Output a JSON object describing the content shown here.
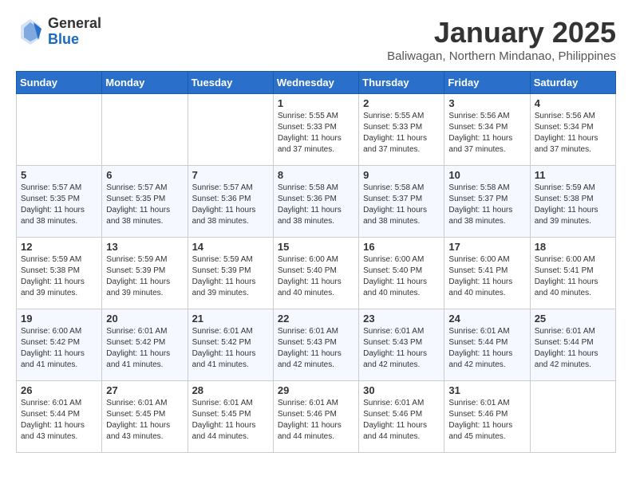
{
  "header": {
    "logo_general": "General",
    "logo_blue": "Blue",
    "month_year": "January 2025",
    "location": "Baliwagan, Northern Mindanao, Philippines"
  },
  "weekdays": [
    "Sunday",
    "Monday",
    "Tuesday",
    "Wednesday",
    "Thursday",
    "Friday",
    "Saturday"
  ],
  "weeks": [
    [
      {
        "day": "",
        "content": ""
      },
      {
        "day": "",
        "content": ""
      },
      {
        "day": "",
        "content": ""
      },
      {
        "day": "1",
        "content": "Sunrise: 5:55 AM\nSunset: 5:33 PM\nDaylight: 11 hours\nand 37 minutes."
      },
      {
        "day": "2",
        "content": "Sunrise: 5:55 AM\nSunset: 5:33 PM\nDaylight: 11 hours\nand 37 minutes."
      },
      {
        "day": "3",
        "content": "Sunrise: 5:56 AM\nSunset: 5:34 PM\nDaylight: 11 hours\nand 37 minutes."
      },
      {
        "day": "4",
        "content": "Sunrise: 5:56 AM\nSunset: 5:34 PM\nDaylight: 11 hours\nand 37 minutes."
      }
    ],
    [
      {
        "day": "5",
        "content": "Sunrise: 5:57 AM\nSunset: 5:35 PM\nDaylight: 11 hours\nand 38 minutes."
      },
      {
        "day": "6",
        "content": "Sunrise: 5:57 AM\nSunset: 5:35 PM\nDaylight: 11 hours\nand 38 minutes."
      },
      {
        "day": "7",
        "content": "Sunrise: 5:57 AM\nSunset: 5:36 PM\nDaylight: 11 hours\nand 38 minutes."
      },
      {
        "day": "8",
        "content": "Sunrise: 5:58 AM\nSunset: 5:36 PM\nDaylight: 11 hours\nand 38 minutes."
      },
      {
        "day": "9",
        "content": "Sunrise: 5:58 AM\nSunset: 5:37 PM\nDaylight: 11 hours\nand 38 minutes."
      },
      {
        "day": "10",
        "content": "Sunrise: 5:58 AM\nSunset: 5:37 PM\nDaylight: 11 hours\nand 38 minutes."
      },
      {
        "day": "11",
        "content": "Sunrise: 5:59 AM\nSunset: 5:38 PM\nDaylight: 11 hours\nand 39 minutes."
      }
    ],
    [
      {
        "day": "12",
        "content": "Sunrise: 5:59 AM\nSunset: 5:38 PM\nDaylight: 11 hours\nand 39 minutes."
      },
      {
        "day": "13",
        "content": "Sunrise: 5:59 AM\nSunset: 5:39 PM\nDaylight: 11 hours\nand 39 minutes."
      },
      {
        "day": "14",
        "content": "Sunrise: 5:59 AM\nSunset: 5:39 PM\nDaylight: 11 hours\nand 39 minutes."
      },
      {
        "day": "15",
        "content": "Sunrise: 6:00 AM\nSunset: 5:40 PM\nDaylight: 11 hours\nand 40 minutes."
      },
      {
        "day": "16",
        "content": "Sunrise: 6:00 AM\nSunset: 5:40 PM\nDaylight: 11 hours\nand 40 minutes."
      },
      {
        "day": "17",
        "content": "Sunrise: 6:00 AM\nSunset: 5:41 PM\nDaylight: 11 hours\nand 40 minutes."
      },
      {
        "day": "18",
        "content": "Sunrise: 6:00 AM\nSunset: 5:41 PM\nDaylight: 11 hours\nand 40 minutes."
      }
    ],
    [
      {
        "day": "19",
        "content": "Sunrise: 6:00 AM\nSunset: 5:42 PM\nDaylight: 11 hours\nand 41 minutes."
      },
      {
        "day": "20",
        "content": "Sunrise: 6:01 AM\nSunset: 5:42 PM\nDaylight: 11 hours\nand 41 minutes."
      },
      {
        "day": "21",
        "content": "Sunrise: 6:01 AM\nSunset: 5:42 PM\nDaylight: 11 hours\nand 41 minutes."
      },
      {
        "day": "22",
        "content": "Sunrise: 6:01 AM\nSunset: 5:43 PM\nDaylight: 11 hours\nand 42 minutes."
      },
      {
        "day": "23",
        "content": "Sunrise: 6:01 AM\nSunset: 5:43 PM\nDaylight: 11 hours\nand 42 minutes."
      },
      {
        "day": "24",
        "content": "Sunrise: 6:01 AM\nSunset: 5:44 PM\nDaylight: 11 hours\nand 42 minutes."
      },
      {
        "day": "25",
        "content": "Sunrise: 6:01 AM\nSunset: 5:44 PM\nDaylight: 11 hours\nand 42 minutes."
      }
    ],
    [
      {
        "day": "26",
        "content": "Sunrise: 6:01 AM\nSunset: 5:44 PM\nDaylight: 11 hours\nand 43 minutes."
      },
      {
        "day": "27",
        "content": "Sunrise: 6:01 AM\nSunset: 5:45 PM\nDaylight: 11 hours\nand 43 minutes."
      },
      {
        "day": "28",
        "content": "Sunrise: 6:01 AM\nSunset: 5:45 PM\nDaylight: 11 hours\nand 44 minutes."
      },
      {
        "day": "29",
        "content": "Sunrise: 6:01 AM\nSunset: 5:46 PM\nDaylight: 11 hours\nand 44 minutes."
      },
      {
        "day": "30",
        "content": "Sunrise: 6:01 AM\nSunset: 5:46 PM\nDaylight: 11 hours\nand 44 minutes."
      },
      {
        "day": "31",
        "content": "Sunrise: 6:01 AM\nSunset: 5:46 PM\nDaylight: 11 hours\nand 45 minutes."
      },
      {
        "day": "",
        "content": ""
      }
    ]
  ]
}
